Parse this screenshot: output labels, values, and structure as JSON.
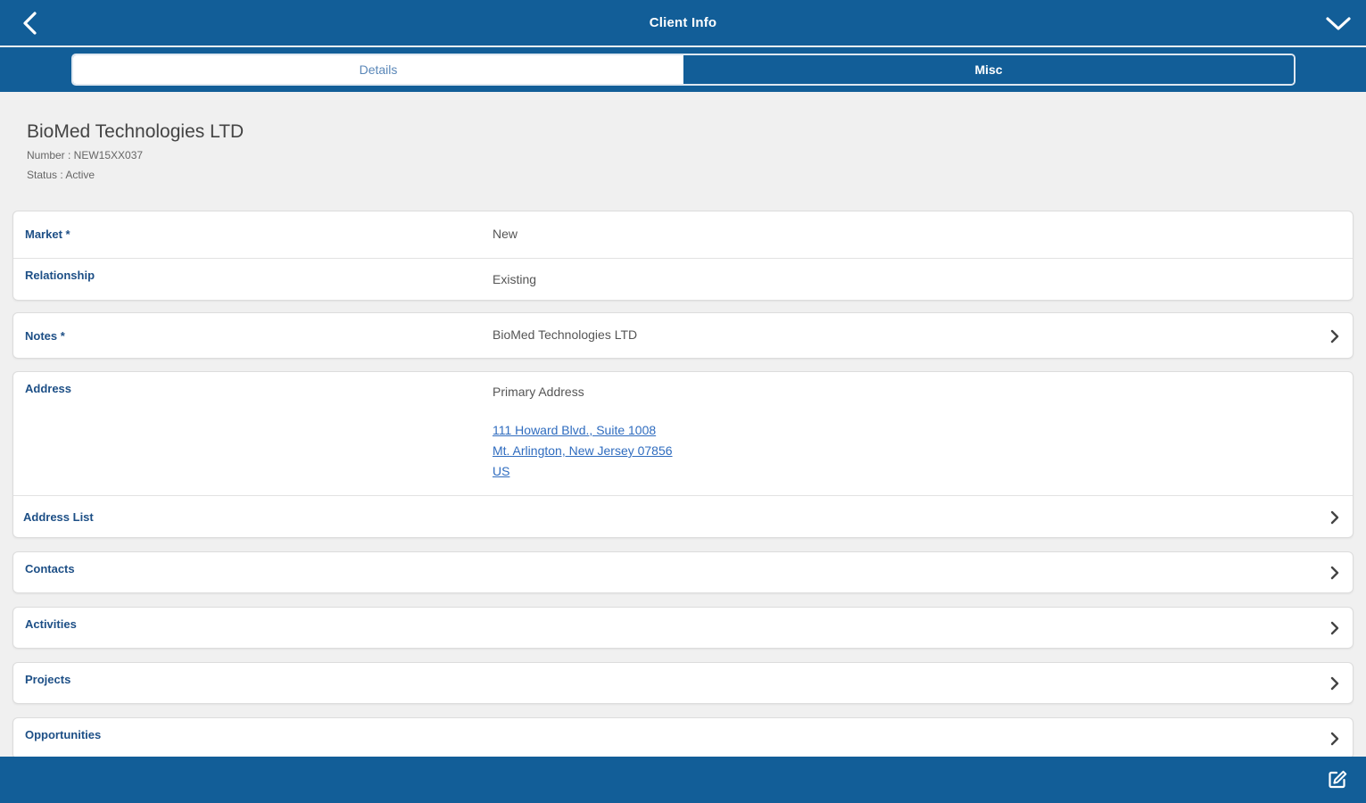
{
  "topbar": {
    "title": "Client Info",
    "back_icon": "chevron-left-icon",
    "collapse_icon": "chevron-down-icon"
  },
  "tabs": [
    {
      "label": "Details",
      "active": true
    },
    {
      "label": "Misc",
      "active": false
    }
  ],
  "client": {
    "name": "BioMed Technologies LTD",
    "number": "Number : NEW15XX037",
    "status": "Status : Active"
  },
  "fields": {
    "market": {
      "label": "Market *",
      "value": "New"
    },
    "relationship": {
      "label": "Relationship",
      "value": "Existing"
    },
    "notes": {
      "label": "Notes *",
      "value": "BioMed Technologies LTD"
    },
    "address": {
      "label": "Address",
      "type": "Primary Address",
      "line1": "111 Howard Blvd., Suite 1008",
      "line2": "Mt. Arlington, New Jersey 07856",
      "line3": "US"
    },
    "address_list": {
      "label": "Address List"
    }
  },
  "nav": {
    "contacts": "Contacts",
    "activities": "Activities",
    "projects": "Projects",
    "opportunities": "Opportunities"
  },
  "bottombar": {
    "edit_icon": "edit-icon"
  },
  "colors": {
    "brand": "#125e98",
    "label": "#1d4f86",
    "link": "#2f6cbf",
    "background": "#f0f0f0"
  }
}
